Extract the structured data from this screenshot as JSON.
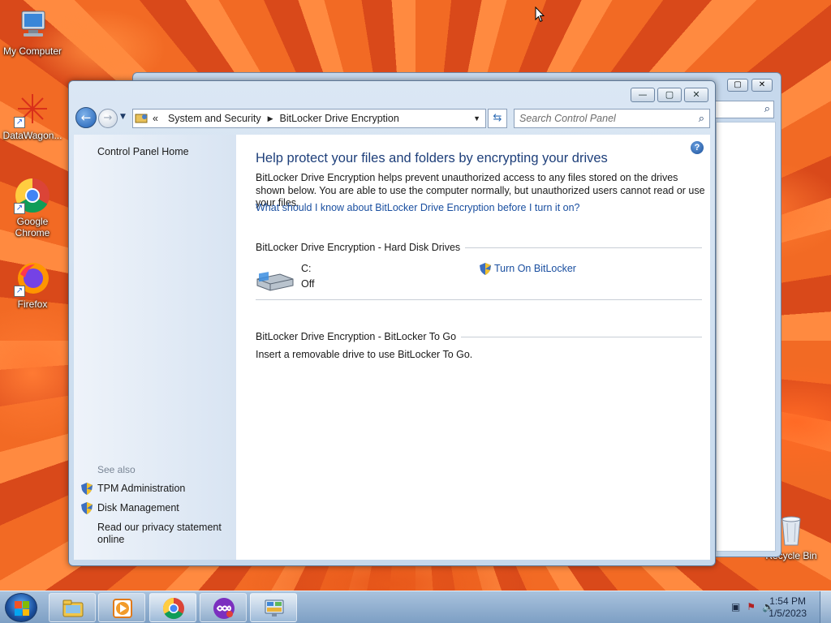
{
  "desktop": {
    "icons": [
      {
        "label": "My Computer",
        "icon": "computer-icon"
      },
      {
        "label": "DataWagon...",
        "icon": "datawagon-icon"
      },
      {
        "label": "Google Chrome",
        "icon": "chrome-icon"
      },
      {
        "label": "Firefox",
        "icon": "firefox-icon"
      },
      {
        "label": "Recycle Bin",
        "icon": "recycle-bin-icon"
      }
    ]
  },
  "window": {
    "breadcrumb": {
      "root_chevron": "«",
      "items": [
        "System and Security",
        "BitLocker Drive Encryption"
      ]
    },
    "search_placeholder": "Search Control Panel",
    "left_pane": {
      "home_link": "Control Panel Home",
      "see_also_heading": "See also",
      "links": [
        "TPM Administration",
        "Disk Management",
        "Read our privacy statement online"
      ]
    },
    "content": {
      "heading": "Help protect your files and folders by encrypting your drives",
      "description": "BitLocker Drive Encryption helps prevent unauthorized access to any files stored on the drives shown below. You are able to use the computer normally, but unauthorized users cannot read or use your files.",
      "learn_more_link": "What should I know about BitLocker Drive Encryption before I turn it on?",
      "hard_disk_section": "BitLocker Drive Encryption - Hard Disk Drives",
      "drive": {
        "name": "C:",
        "status": "Off",
        "action": "Turn On BitLocker"
      },
      "to_go_section": "BitLocker Drive Encryption - BitLocker To Go",
      "to_go_text": "Insert a removable drive to use BitLocker To Go."
    }
  },
  "taskbar": {
    "pinned": [
      "explorer-icon",
      "media-player-icon",
      "chrome-icon",
      "app-icon",
      "control-panel-icon"
    ],
    "clock_time": "1:54 PM",
    "clock_date": "1/5/2023"
  },
  "colors": {
    "heading": "#1e3f7a",
    "link": "#1a4fa0",
    "wallpaper": "#e85a1e"
  }
}
